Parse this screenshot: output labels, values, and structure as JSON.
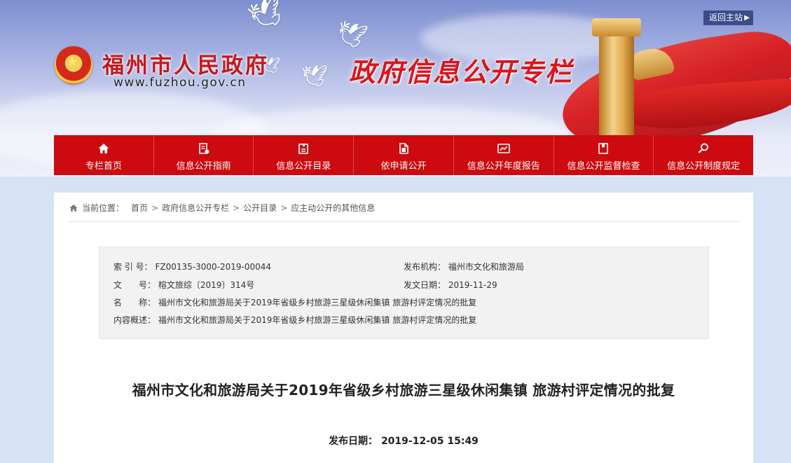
{
  "header": {
    "site_title": "福州市人民政府",
    "site_url": "www.fuzhou.gov.cn",
    "column_title": "政府信息公开专栏",
    "return_label": "返回主站"
  },
  "nav": {
    "items": [
      {
        "label": "专栏首页",
        "icon": "home-icon"
      },
      {
        "label": "信息公开指南",
        "icon": "guide-icon"
      },
      {
        "label": "信息公开目录",
        "icon": "catalog-icon"
      },
      {
        "label": "依申请公开",
        "icon": "document-icon"
      },
      {
        "label": "信息公开年度报告",
        "icon": "report-icon"
      },
      {
        "label": "信息公开监督检查",
        "icon": "supervision-icon"
      },
      {
        "label": "信息公开制度规定",
        "icon": "search-icon"
      }
    ]
  },
  "breadcrumb": {
    "label": "当前位置：",
    "items": [
      "首页",
      "政府信息公开专栏",
      "公开目录",
      "应主动公开的其他信息"
    ],
    "separator": ">"
  },
  "meta": {
    "index_key": "索 引 号：",
    "index_value": "FZ00135-3000-2019-00044",
    "publisher_key": "发布机构：",
    "publisher_value": "福州市文化和旅游局",
    "docno_key": "文　　号：",
    "docno_value": "榕文旅综〔2019〕314号",
    "issue_date_key": "发文日期：",
    "issue_date_value": "2019-11-29",
    "name_key": "名　　称：",
    "name_value": "福州市文化和旅游局关于2019年省级乡村旅游三星级休闲集镇 旅游村评定情况的批复",
    "summary_key": "内容概述：",
    "summary_value": "福州市文化和旅游局关于2019年省级乡村旅游三星级休闲集镇 旅游村评定情况的批复"
  },
  "document": {
    "title": "福州市文化和旅游局关于2019年省级乡村旅游三星级休闲集镇 旅游村评定情况的批复",
    "publish_label": "发布日期：",
    "publish_date": "2019-12-05 15:49"
  },
  "colors": {
    "nav_red": "#cd0a0f",
    "title_red": "#c4171b",
    "page_bg": "#d6e3f6",
    "return_bg": "#3a4d8a"
  }
}
